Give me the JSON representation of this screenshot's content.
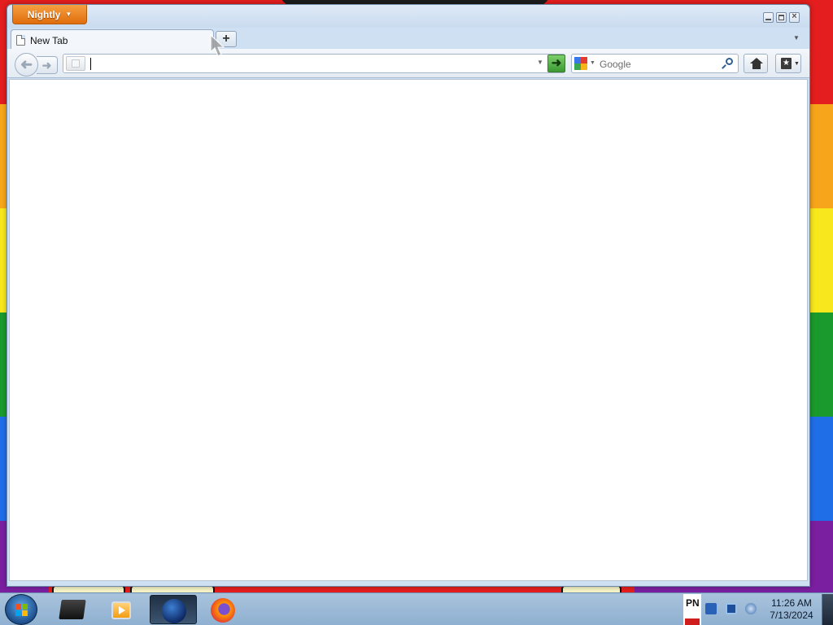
{
  "browser": {
    "app_menu_label": "Nightly",
    "tab": {
      "title": "New Tab"
    },
    "url_bar": {
      "value": "",
      "placeholder": ""
    },
    "search_bar": {
      "engine": "Google",
      "placeholder": "Google"
    }
  },
  "taskbar": {
    "tray_language": "PN",
    "clock": {
      "time": "11:26 AM",
      "date": "7/13/2024"
    }
  },
  "colors": {
    "app_button": "#e9781b",
    "go_button": "#3c9a33",
    "window_frame": "#cfe0f3",
    "stripes": [
      "#e41e1e",
      "#f7a51a",
      "#f8e71c",
      "#1a9a2c",
      "#1f6ee8",
      "#7a1fa0"
    ]
  },
  "icons": [
    "dropdown-caret-icon",
    "minimize-icon",
    "maximize-icon",
    "close-icon",
    "blank-page-icon",
    "plus-icon",
    "back-arrow-icon",
    "forward-arrow-icon",
    "go-arrow-icon",
    "google-icon",
    "magnifier-icon",
    "home-icon",
    "bookmarks-icon",
    "windows-logo-icon",
    "explorer-icon",
    "media-player-icon",
    "nightly-icon",
    "firefox-icon"
  ]
}
